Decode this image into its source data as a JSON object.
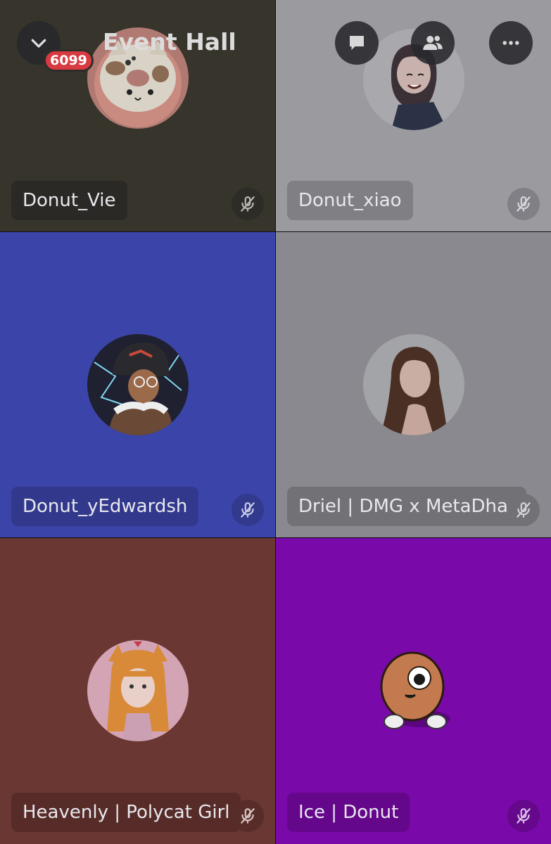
{
  "header": {
    "title": "Event Hall",
    "badge_count": "6099",
    "icons": [
      "chevron-down-icon",
      "chat-bubble-icon",
      "members-icon",
      "more-options-icon"
    ]
  },
  "tiles": [
    {
      "name": "Donut_Vie",
      "bg": "#36342b",
      "pill_bg": "#2a2925",
      "mute_bg": "#2d2c27",
      "avatar": "cat-donut",
      "muted": true
    },
    {
      "name": "Donut_xiao",
      "bg": "#9b9a9f",
      "pill_bg": "#807f84",
      "mute_bg": "#818086",
      "avatar": "anime-girl-bob",
      "muted": true
    },
    {
      "name": "Donut_yEdwardsh",
      "bg": "#3b45a9",
      "pill_bg": "#32398c",
      "mute_bg": "#313a8d",
      "avatar": "hat-boy",
      "muted": true
    },
    {
      "name": "Driel | DMG x MetaDhana",
      "bg": "#8a898f",
      "pill_bg": "#727176",
      "mute_bg": "#727176",
      "avatar": "photo-woman",
      "muted": true
    },
    {
      "name": "Heavenly | Polycat Girl",
      "bg": "#6a3732",
      "pill_bg": "#572c28",
      "mute_bg": "#582d29",
      "avatar": "fox-girl",
      "muted": true
    },
    {
      "name": "Ice | Donut",
      "bg": "#7a09a9",
      "pill_bg": "#65078b",
      "mute_bg": "#65088c",
      "avatar": "donut-monster",
      "muted": true
    }
  ]
}
